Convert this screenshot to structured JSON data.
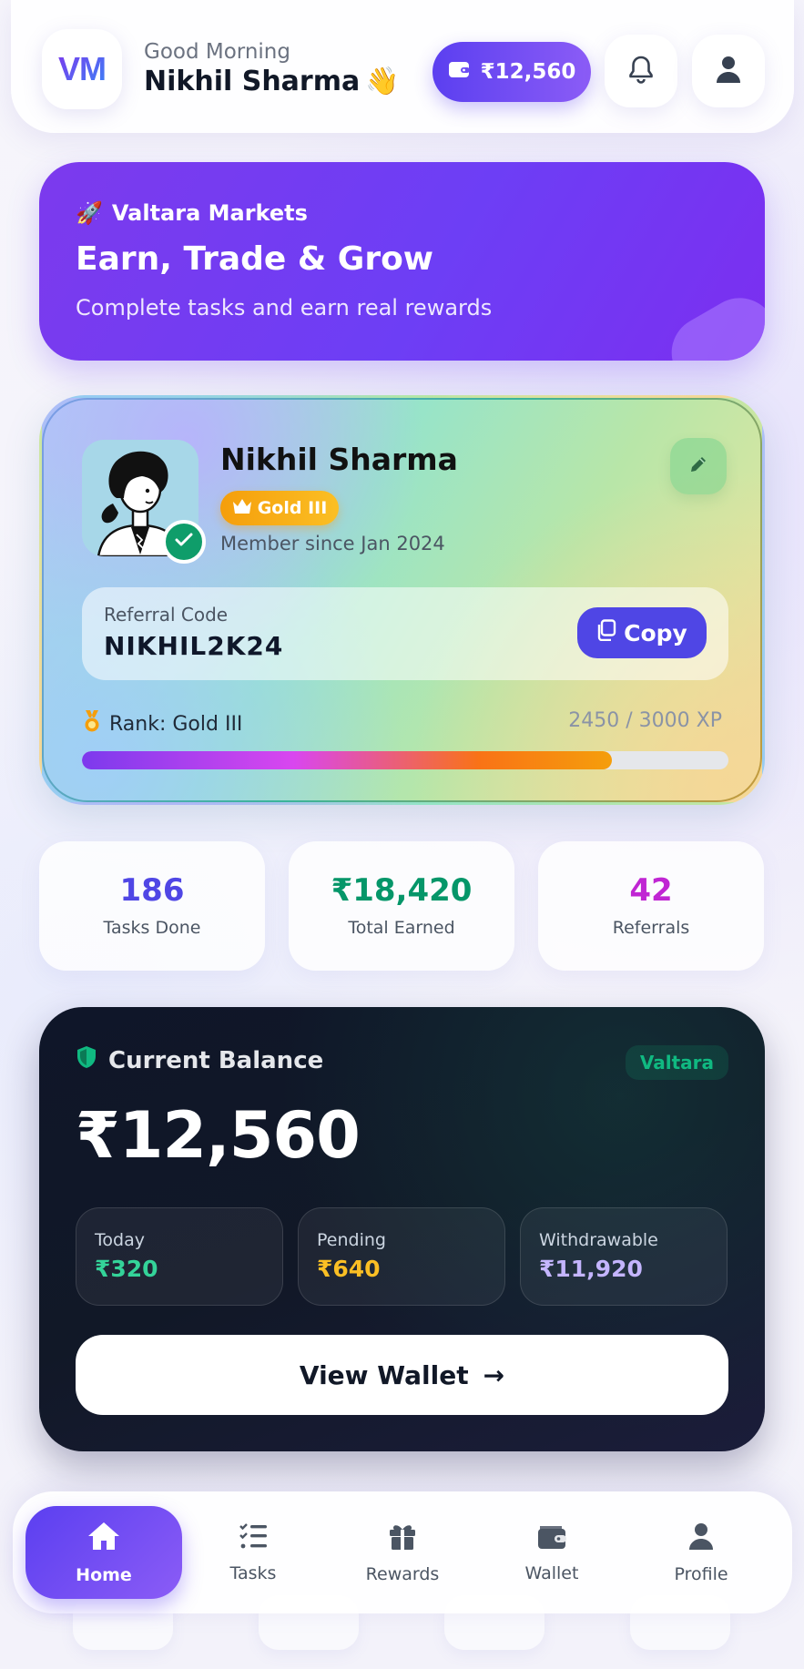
{
  "header": {
    "logo_text": "VM",
    "greeting": "Good Morning",
    "user_name": "Nikhil Sharma",
    "wave_emoji": "👋",
    "balance_pill": "₹12,560",
    "icons": [
      "wallet-icon",
      "bell-icon",
      "user-icon"
    ]
  },
  "hero": {
    "brand": "Valtara Markets",
    "brand_emoji": "🚀",
    "title": "Earn, Trade & Grow",
    "subtitle": "Complete tasks and earn real rewards"
  },
  "profile": {
    "name": "Nikhil Sharma",
    "tier_badge": "Gold III",
    "member_since": "Member since Jan 2024",
    "referral_label": "Referral Code",
    "referral_code": "NIKHIL2K24",
    "copy_label": "Copy",
    "rank_label": "Rank: Gold III",
    "xp_text": "2450 / 3000 XP",
    "xp_progress": 0.82
  },
  "stats": [
    {
      "value": "186",
      "label": "Tasks Done",
      "color": "#4f46e5"
    },
    {
      "value": "₹18,420",
      "label": "Total Earned",
      "color": "#059669"
    },
    {
      "value": "42",
      "label": "Referrals",
      "color": "#c026d3"
    }
  ],
  "balance": {
    "heading": "Current Balance",
    "tag": "Valtara",
    "amount": "₹12,560",
    "breakdown": [
      {
        "label": "Today",
        "value": "₹320",
        "color": "#34d399"
      },
      {
        "label": "Pending",
        "value": "₹640",
        "color": "#fbbf24"
      },
      {
        "label": "Withdrawable",
        "value": "₹11,920",
        "color": "#c4b5fd"
      }
    ],
    "button_label": "View Wallet",
    "button_arrow": "→"
  },
  "nav": {
    "items": [
      {
        "label": "Home",
        "icon": "home-icon",
        "active": true
      },
      {
        "label": "Tasks",
        "icon": "tasks-icon",
        "active": false
      },
      {
        "label": "Rewards",
        "icon": "gift-icon",
        "active": false
      },
      {
        "label": "Wallet",
        "icon": "wallet-icon",
        "active": false
      },
      {
        "label": "Profile",
        "icon": "user-icon",
        "active": false
      }
    ]
  },
  "colors": {
    "accent": "#5b3ff0",
    "hero": "#7c3aed",
    "success": "#0f9d6a",
    "gold": "#f59e0b",
    "dark_card": "#111827"
  }
}
